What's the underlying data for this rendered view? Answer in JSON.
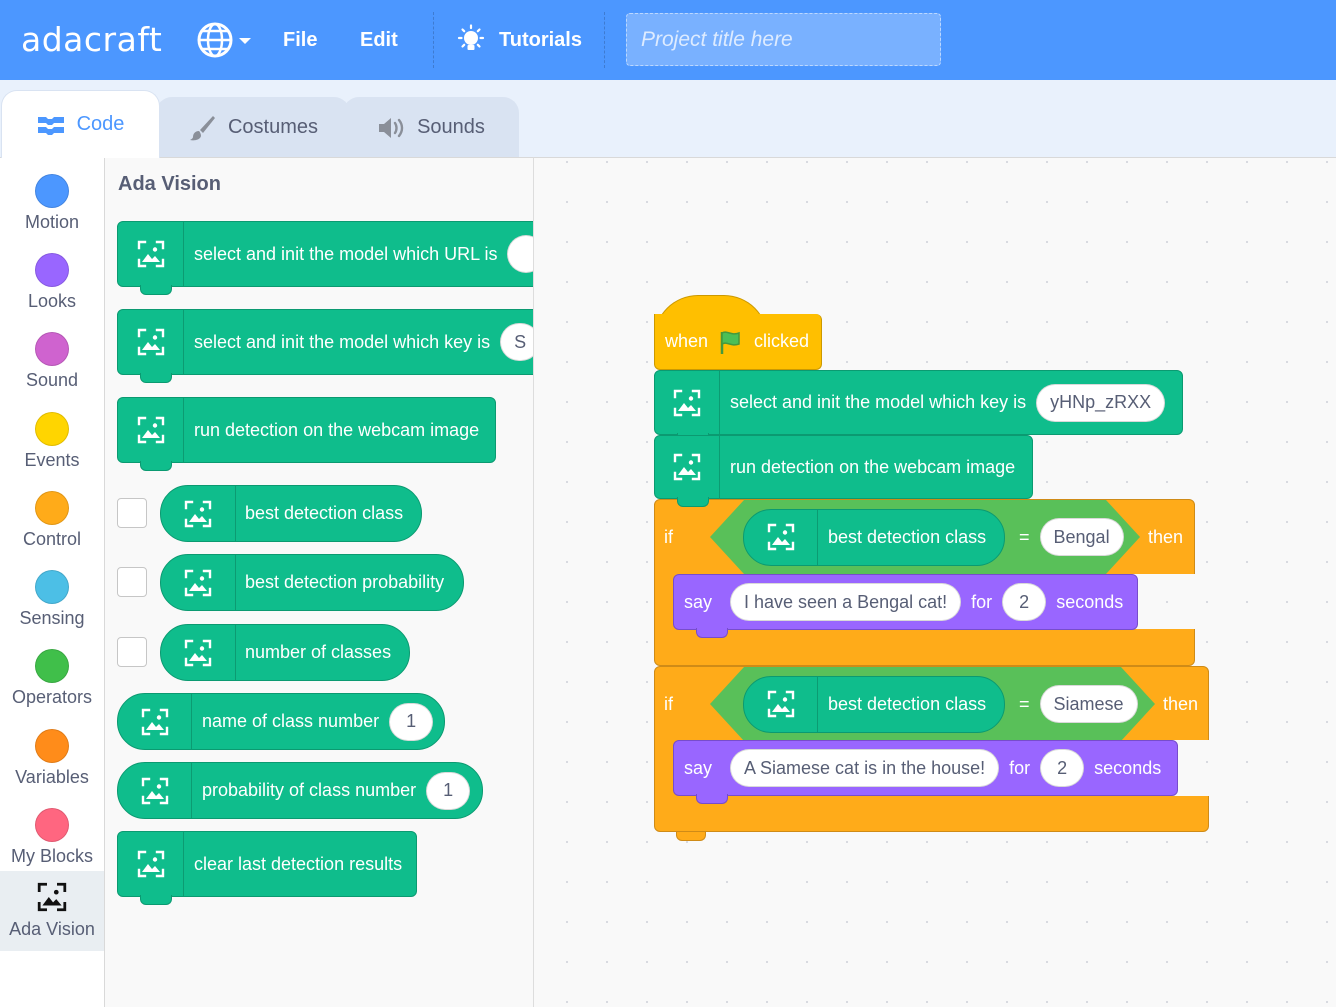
{
  "app": {
    "logo": "adacraft"
  },
  "menu": {
    "file": "File",
    "edit": "Edit",
    "tutorials": "Tutorials",
    "project_title_placeholder": "Project title here"
  },
  "tabs": {
    "code": "Code",
    "costumes": "Costumes",
    "sounds": "Sounds"
  },
  "categories": [
    {
      "label": "Motion",
      "color": "#4c97ff"
    },
    {
      "label": "Looks",
      "color": "#9966ff"
    },
    {
      "label": "Sound",
      "color": "#cf63cf"
    },
    {
      "label": "Events",
      "color": "#ffd500"
    },
    {
      "label": "Control",
      "color": "#ffab19"
    },
    {
      "label": "Sensing",
      "color": "#4cbfe6"
    },
    {
      "label": "Operators",
      "color": "#40bf4a"
    },
    {
      "label": "Variables",
      "color": "#ff8c1a"
    },
    {
      "label": "My Blocks",
      "color": "#ff6680"
    },
    {
      "label": "Ada Vision",
      "icon": "ada-vision-icon"
    }
  ],
  "palette": {
    "heading": "Ada Vision",
    "blocks": {
      "init_url": "select and init the model which URL is",
      "init_key": "select and init the model which key is",
      "init_key_slot": "S",
      "run_detection": "run detection on the webcam image",
      "best_class": "best detection class",
      "best_prob": "best detection probability",
      "num_classes": "number of classes",
      "name_class": "name of class number",
      "name_class_val": "1",
      "prob_class": "probability of class number",
      "prob_class_val": "1",
      "clear": "clear last detection results"
    }
  },
  "script": {
    "hat_when": "when",
    "hat_clicked": "clicked",
    "init_key": "select and init the model which key is",
    "model_key": "yHNp_zRXX",
    "run_detection": "run detection on the webcam image",
    "if1": {
      "if": "if",
      "reporter": "best detection class",
      "eq": "=",
      "value": "Bengal",
      "then": "then"
    },
    "say1": {
      "say": "say",
      "message": "I have seen a Bengal cat!",
      "for": "for",
      "secs": "2",
      "seconds": "seconds"
    },
    "if2": {
      "if": "if",
      "reporter": "best detection class",
      "eq": "=",
      "value": "Siamese",
      "then": "then"
    },
    "say2": {
      "say": "say",
      "message": "A Siamese cat is in the house!",
      "for": "for",
      "secs": "2",
      "seconds": "seconds"
    }
  },
  "colors": {
    "menubar": "#4c97ff",
    "ada_vision": "#0fbd8c",
    "events": "#ffbf00",
    "control": "#ffab19",
    "looks": "#9966ff",
    "operators": "#59c059"
  }
}
